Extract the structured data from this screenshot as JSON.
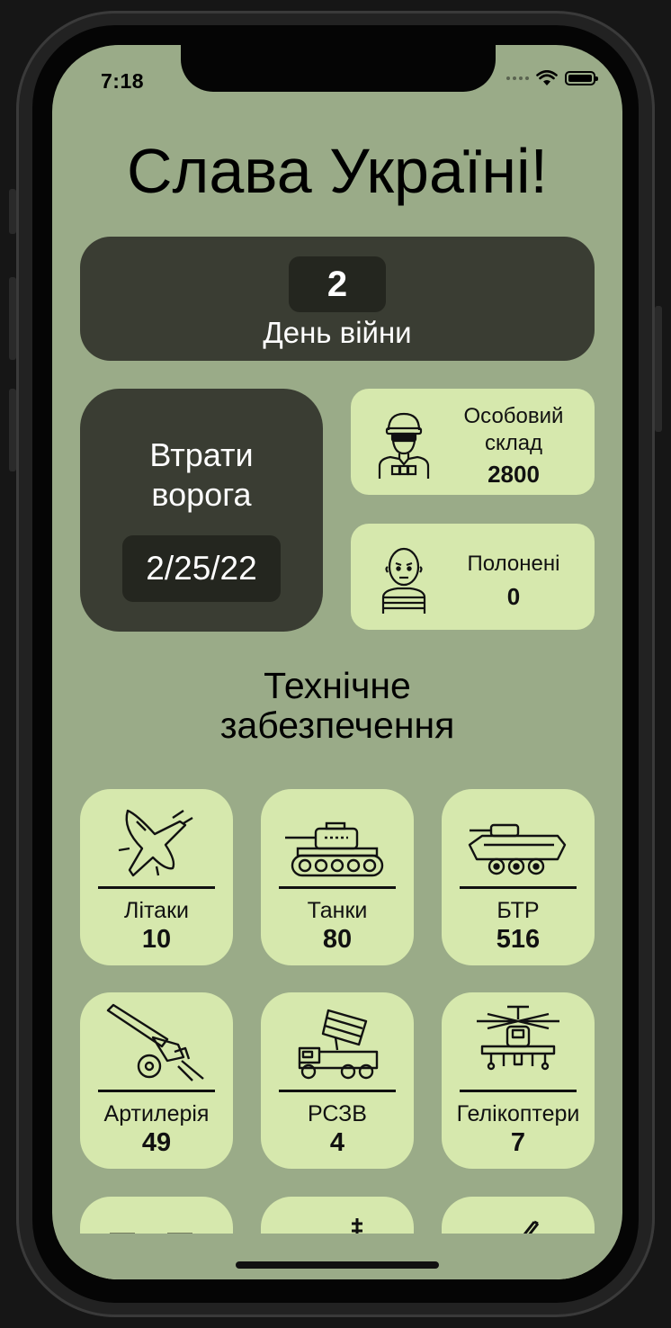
{
  "status_bar": {
    "time": "7:18"
  },
  "header": {
    "title": "Слава Україні!"
  },
  "day_card": {
    "number": "2",
    "label": "День війни"
  },
  "losses_card": {
    "title_line1": "Втрати",
    "title_line2": "ворога",
    "date": "2/25/22"
  },
  "personnel": {
    "label_line1": "Особовий",
    "label_line2": "склад",
    "value": "2800",
    "icon": "soldier-icon"
  },
  "prisoners": {
    "label": "Полонені",
    "value": "0",
    "icon": "prisoner-icon"
  },
  "equipment_section": {
    "title_line1": "Технічне",
    "title_line2": "забезпечення"
  },
  "equipment": [
    {
      "label": "Літаки",
      "value": "10",
      "icon": "jet-icon"
    },
    {
      "label": "Танки",
      "value": "80",
      "icon": "tank-icon"
    },
    {
      "label": "БТР",
      "value": "516",
      "icon": "apc-icon"
    },
    {
      "label": "Артилерія",
      "value": "49",
      "icon": "artillery-icon"
    },
    {
      "label": "РСЗВ",
      "value": "4",
      "icon": "rocket-launcher-icon"
    },
    {
      "label": "Гелікоптери",
      "value": "7",
      "icon": "helicopter-icon"
    }
  ],
  "colors": {
    "screen_bg": "#9aab88",
    "dark_card": "#3a3d33",
    "light_card": "#d6e8ad"
  }
}
